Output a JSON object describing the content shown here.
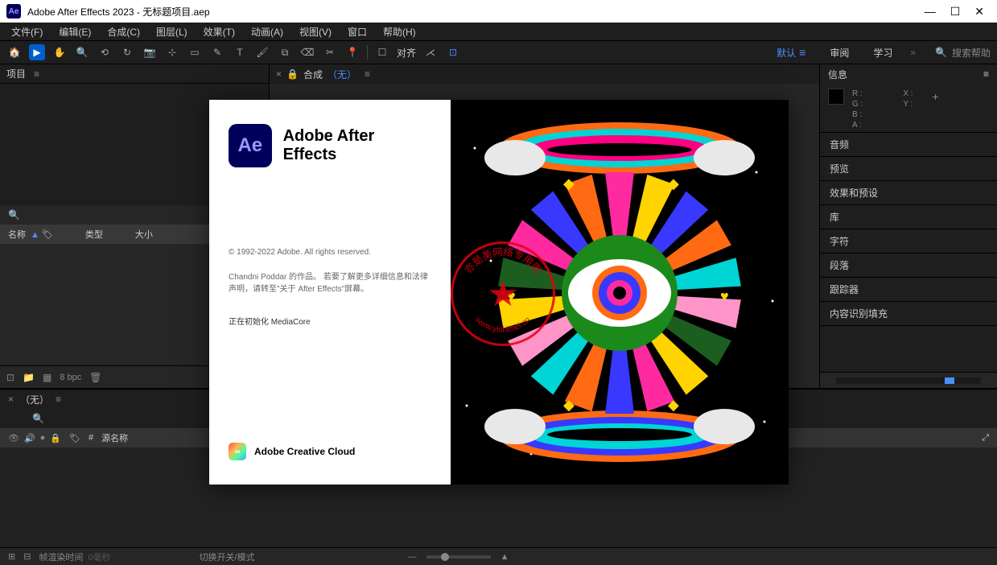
{
  "titlebar": {
    "logo_text": "Ae",
    "title": "Adobe After Effects 2023 - 无标题项目.aep"
  },
  "menubar": [
    "文件(F)",
    "编辑(E)",
    "合成(C)",
    "图层(L)",
    "效果(T)",
    "动画(A)",
    "视图(V)",
    "窗口",
    "帮助(H)"
  ],
  "toolbar": {
    "snap_label": "对齐",
    "workspaces": [
      "默认",
      "审阅",
      "学习"
    ],
    "search_placeholder": "搜索帮助"
  },
  "project_panel": {
    "title": "项目",
    "columns": {
      "name": "名称",
      "type": "类型",
      "size": "大小"
    },
    "bpc": "8 bpc"
  },
  "comp_panel": {
    "title": "合成",
    "none": "（无）"
  },
  "info_panel": {
    "title": "信息",
    "r": "R :",
    "g": "G :",
    "b": "B :",
    "a": "A :",
    "x": "X :",
    "y": "Y :"
  },
  "right_panels": [
    "音频",
    "预览",
    "效果和预设",
    "库",
    "字符",
    "段落",
    "跟踪器",
    "内容识别填充"
  ],
  "timeline": {
    "none": "（无）",
    "source_name": "源名称",
    "frame_render": "帧渲染时间",
    "frame_ms": "0毫秒",
    "toggle_modes": "切换开关/模式"
  },
  "splash": {
    "logo_text": "Ae",
    "title": "Adobe After Effects",
    "copyright": "© 1992-2022 Adobe. All rights reserved.",
    "credits": "Chandni Poddar 的作品。 若要了解更多详细信息和法律声明，请转至\"关于 After Effects\"屏幕。",
    "initializing": "正在初始化 MediaCore",
    "cc_label": "Adobe Creative Cloud"
  },
  "stamp": {
    "top_text": "亦是美网络专用图",
    "bottom_text": "www.yishimei.cn"
  }
}
